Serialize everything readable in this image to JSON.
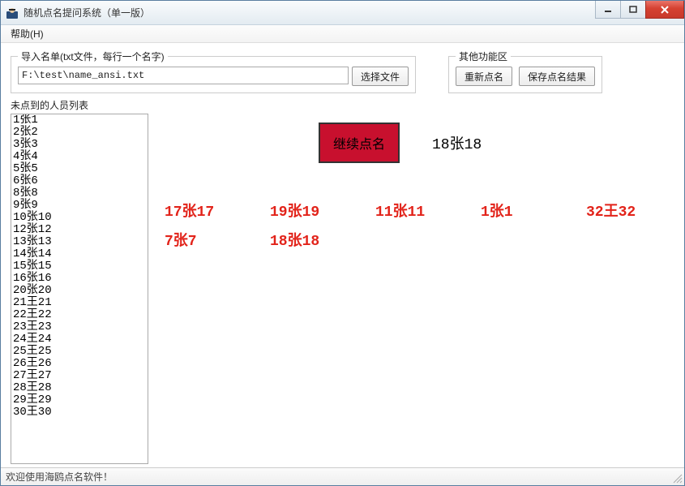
{
  "window": {
    "title": "随机点名提问系统（单一版）"
  },
  "menubar": {
    "help": "帮助(H)"
  },
  "import": {
    "legend": "导入名单(txt文件，每行一个名字)",
    "path": "F:\\test\\name_ansi.txt",
    "choose_label": "选择文件"
  },
  "other": {
    "legend": "其他功能区",
    "restart_label": "重新点名",
    "save_label": "保存点名结果"
  },
  "leftlist": {
    "label": "未点到的人员列表",
    "items": [
      "1张1",
      "2张2",
      "3张3",
      "4张4",
      "5张5",
      "6张6",
      "8张8",
      "9张9",
      "10张10",
      "12张12",
      "13张13",
      "14张14",
      "15张15",
      "16张16",
      "20张20",
      "21王21",
      "22王22",
      "23王23",
      "24王24",
      "25王25",
      "26王26",
      "27王27",
      "28王28",
      "29王29",
      "30王30"
    ]
  },
  "main_button": {
    "label": "继续点名"
  },
  "current": "18张18",
  "called": [
    "17张17",
    "19张19",
    "11张11",
    "1张1",
    "32王32",
    "7张7",
    "18张18"
  ],
  "statusbar": {
    "text": "欢迎使用海鸥点名软件！"
  }
}
